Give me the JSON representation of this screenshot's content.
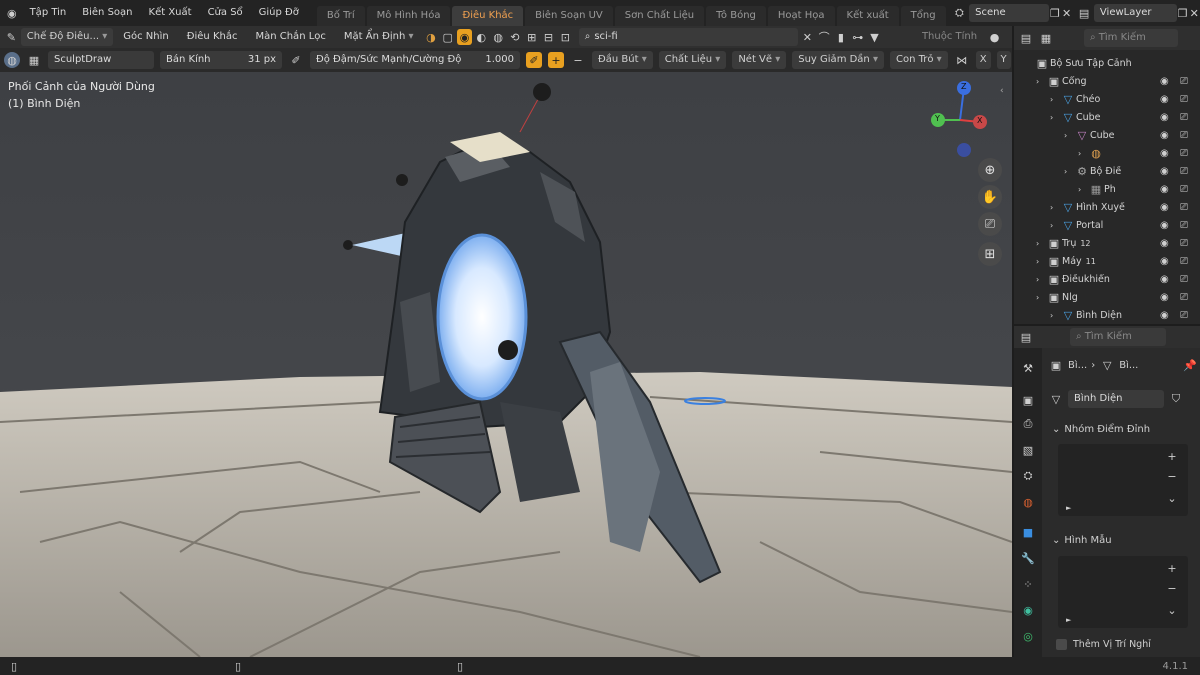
{
  "menu": {
    "logo": "blender-logo-icon",
    "items": [
      "Tập Tin",
      "Biên Soạn",
      "Kết Xuất",
      "Cửa Sổ",
      "Giúp Đỡ"
    ]
  },
  "workspaces": {
    "tabs": [
      "Bố Trí",
      "Mô Hình Hóa",
      "Điêu Khắc",
      "Biên Soạn UV",
      "Sơn Chất Liệu",
      "Tô Bóng",
      "Hoạt Họa",
      "Kết xuất",
      "Tổng"
    ],
    "active": "Điêu Khắc"
  },
  "scene": {
    "name": "Scene"
  },
  "viewlayer": {
    "name": "ViewLayer"
  },
  "header1": {
    "mode": "Chế Độ Điêu...",
    "items": [
      "Góc Nhìn",
      "Điêu Khắc",
      "Màn Chắn Lọc",
      "Mặt Ẩn Định"
    ],
    "search_value": "sci-fi",
    "properties_label": "Thuộc Tính"
  },
  "header2": {
    "brush_name": "SculptDraw",
    "radius_label": "Bán Kính",
    "radius_value": "31 px",
    "strength_label": "Độ Đậm/Sức Mạnh/Cường Độ",
    "strength_value": "1.000",
    "dropdowns": [
      "Đầu Bút",
      "Chất Liệu",
      "Nét Vẽ",
      "Suy Giảm Dần",
      "Con Trỏ"
    ],
    "axis_x": "X",
    "axis_y": "Y"
  },
  "viewport": {
    "perspective": "Phối Cảnh của Người Dùng",
    "object": "(1) Bình Diện",
    "gizmo": {
      "x": "X",
      "y": "Y",
      "z": "Z"
    }
  },
  "outliner": {
    "search_placeholder": "Tìm Kiếm",
    "root": "Bộ Sưu Tập Cảnh",
    "rows": [
      {
        "label": "Cổng",
        "extra": ""
      },
      {
        "label": "Chéo",
        "extra": ""
      },
      {
        "label": "Cube",
        "extra": ""
      },
      {
        "label": "Cube",
        "extra": ""
      },
      {
        "label": "",
        "extra": ""
      },
      {
        "label": "Bộ Điề",
        "extra": ""
      },
      {
        "label": "Ph",
        "extra": ""
      },
      {
        "label": "Hình Xuyế",
        "extra": ""
      },
      {
        "label": "Portal",
        "extra": ""
      },
      {
        "label": "Trụ",
        "extra": "12"
      },
      {
        "label": "Máy",
        "extra": "11"
      },
      {
        "label": "Điềukhiển",
        "extra": ""
      },
      {
        "label": "Nlg",
        "extra": ""
      },
      {
        "label": "Bình Diện",
        "extra": ""
      }
    ]
  },
  "properties": {
    "search_placeholder": "Tìm Kiếm",
    "breadcrumb": [
      "Bì...",
      "Bì..."
    ],
    "mesh_name": "Bình Diện",
    "vertex_groups": "Nhóm Điểm Đỉnh",
    "shape_keys": "Hình Mẫu",
    "checkbox_label": "Thêm Vị Trí Nghỉ"
  },
  "status": {
    "version": "4.1.1"
  }
}
